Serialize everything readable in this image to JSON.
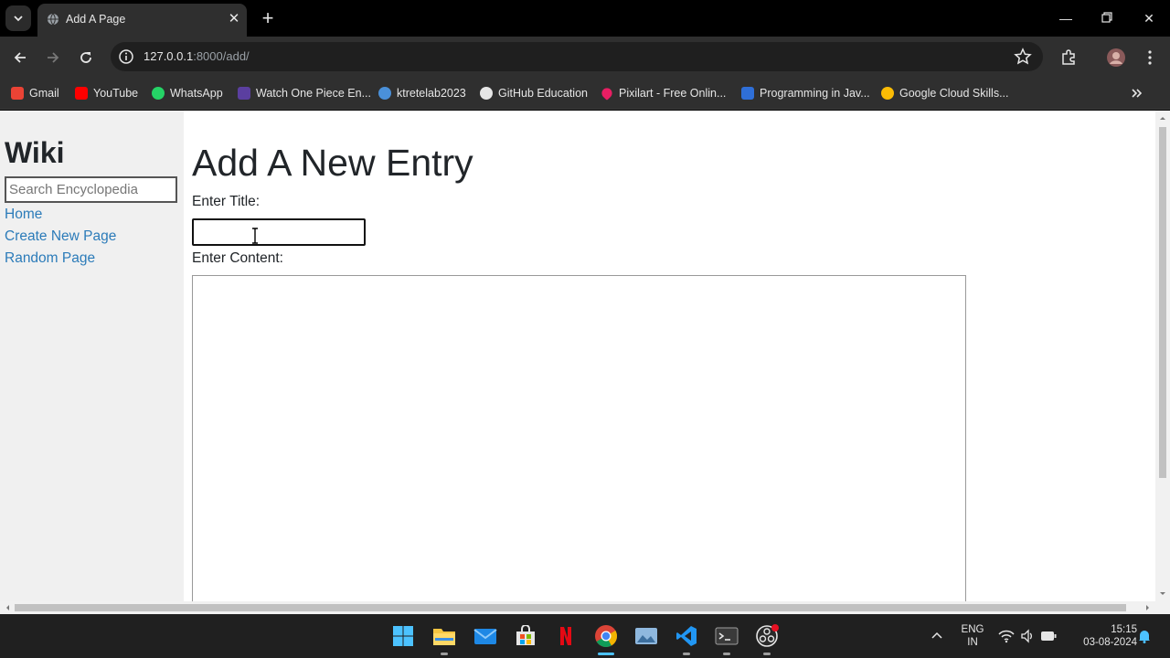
{
  "browser": {
    "tab_title": "Add A Page",
    "url_host": "127.0.0.1",
    "url_path": ":8000/add/"
  },
  "bookmarks": [
    {
      "label": "Gmail",
      "color": "#ea4335"
    },
    {
      "label": "YouTube",
      "color": "#ff0000"
    },
    {
      "label": "WhatsApp",
      "color": "#25d366"
    },
    {
      "label": "Watch One Piece En...",
      "color": "#5b3fa0"
    },
    {
      "label": "ktretelab2023",
      "color": "#4a90d9"
    },
    {
      "label": "GitHub Education",
      "color": "#e6e6e6"
    },
    {
      "label": "Pixilart - Free Onlin...",
      "color": "#e91e63"
    },
    {
      "label": "Programming in Jav...",
      "color": "#2f6fd8"
    },
    {
      "label": "Google Cloud Skills...",
      "color": "#fbbc05"
    }
  ],
  "sidebar": {
    "title": "Wiki",
    "search_placeholder": "Search Encyclopedia",
    "links": [
      "Home",
      "Create New Page",
      "Random Page"
    ]
  },
  "main": {
    "heading": "Add A New Entry",
    "title_label": "Enter Title:",
    "title_value": "",
    "content_label": "Enter Content:"
  },
  "taskbar": {
    "lang_top": "ENG",
    "lang_bottom": "IN",
    "time": "15:15",
    "date": "03-08-2024"
  },
  "colors": {
    "link": "#2b7bb9",
    "sidebar_bg": "#f0f0f0"
  }
}
